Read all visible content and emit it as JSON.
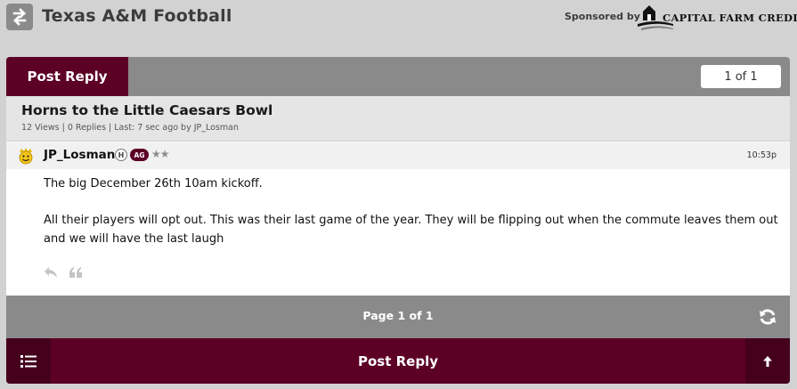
{
  "header": {
    "board_title": "Texas A&M Football",
    "sponsor_label": "Sponsored by",
    "sponsor_name": "CAPITAL FARM CREDIT",
    "back_icon": "swap-arrows-icon"
  },
  "thread": {
    "post_reply_label": "Post Reply",
    "page_indicator": "1 of 1",
    "title": "Horns to the Little Caesars Bowl",
    "meta": "12 Views | 0 Replies | Last: 7 sec ago by JP_Losman"
  },
  "post": {
    "username": "JP_Losman",
    "badge_h": "H",
    "badge_ag": "AG",
    "stars": "★★",
    "time": "10:53p",
    "body_line1": "The big December 26th 10am kickoff.",
    "body_line2": "All their players will opt out. This was their last game of the year. They will be flipping out when the commute leaves them out and we will have the last laugh",
    "action_icons": [
      "reply-icon",
      "quote-icon"
    ]
  },
  "pager": {
    "label": "Page 1 of 1",
    "refresh_icon": "refresh-icon"
  },
  "footer": {
    "post_reply_label": "Post Reply",
    "list_icon": "list-icon",
    "up_icon": "arrow-up-icon"
  },
  "colors": {
    "maroon": "#5c0025",
    "maroon_dark": "#45001b",
    "bar_gray": "#8a8a8a",
    "page_bg": "#d2d2d2"
  }
}
